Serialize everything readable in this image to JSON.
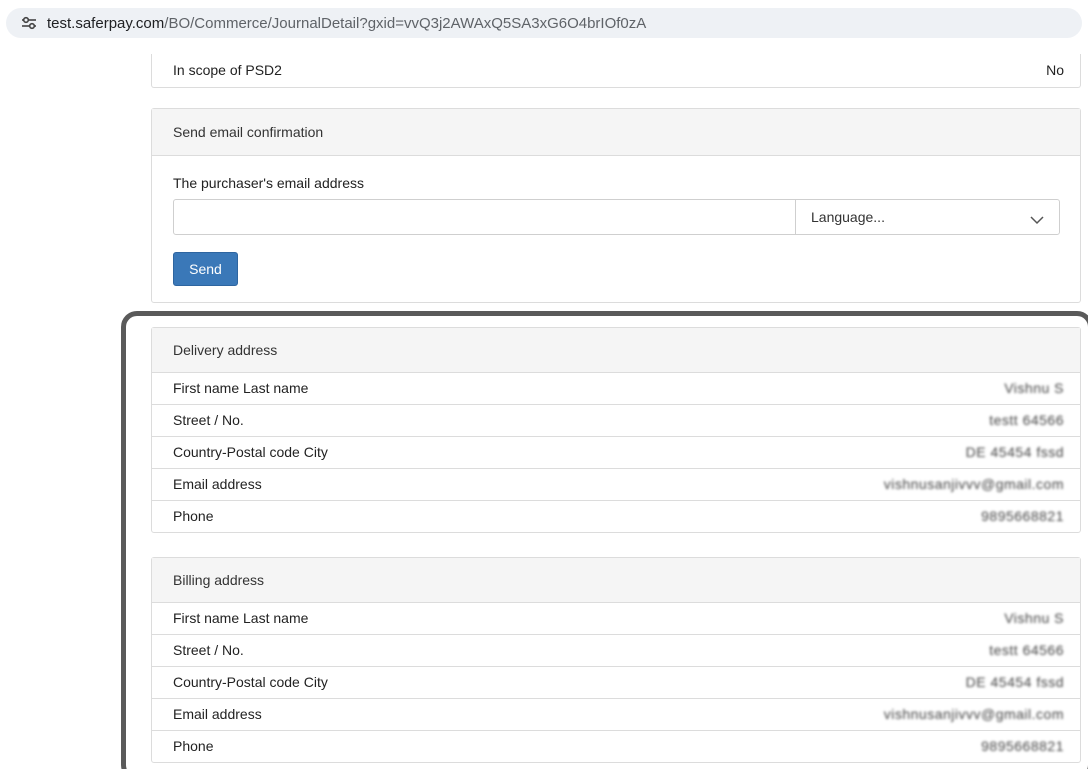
{
  "browser": {
    "url_host": "test.saferpay.com",
    "url_path": "/BO/Commerce/JournalDetail?gxid=vvQ3j2AWAxQ5SA3xG6O4brIOf0zA",
    "site_icon": "tune-icon"
  },
  "psd2": {
    "label": "In scope of PSD2",
    "value": "No"
  },
  "email_confirmation": {
    "title": "Send email confirmation",
    "field_label": "The purchaser's email address",
    "email_value": "",
    "language_placeholder": "Language...",
    "send_label": "Send",
    "accent_color": "#3a78b8"
  },
  "delivery": {
    "title": "Delivery address",
    "rows": [
      {
        "key": "First name Last name",
        "value": "Vishnu S"
      },
      {
        "key": "Street / No.",
        "value": "testt 64566"
      },
      {
        "key": "Country-Postal code City",
        "value": "DE 45454 fssd"
      },
      {
        "key": "Email address",
        "value": "vishnusanjivvv@gmail.com"
      },
      {
        "key": "Phone",
        "value": "9895668821"
      }
    ]
  },
  "billing": {
    "title": "Billing address",
    "rows": [
      {
        "key": "First name Last name",
        "value": "Vishnu S"
      },
      {
        "key": "Street / No.",
        "value": "testt 64566"
      },
      {
        "key": "Country-Postal code City",
        "value": "DE 45454 fssd"
      },
      {
        "key": "Email address",
        "value": "vishnusanjivvv@gmail.com"
      },
      {
        "key": "Phone",
        "value": "9895668821"
      }
    ]
  }
}
